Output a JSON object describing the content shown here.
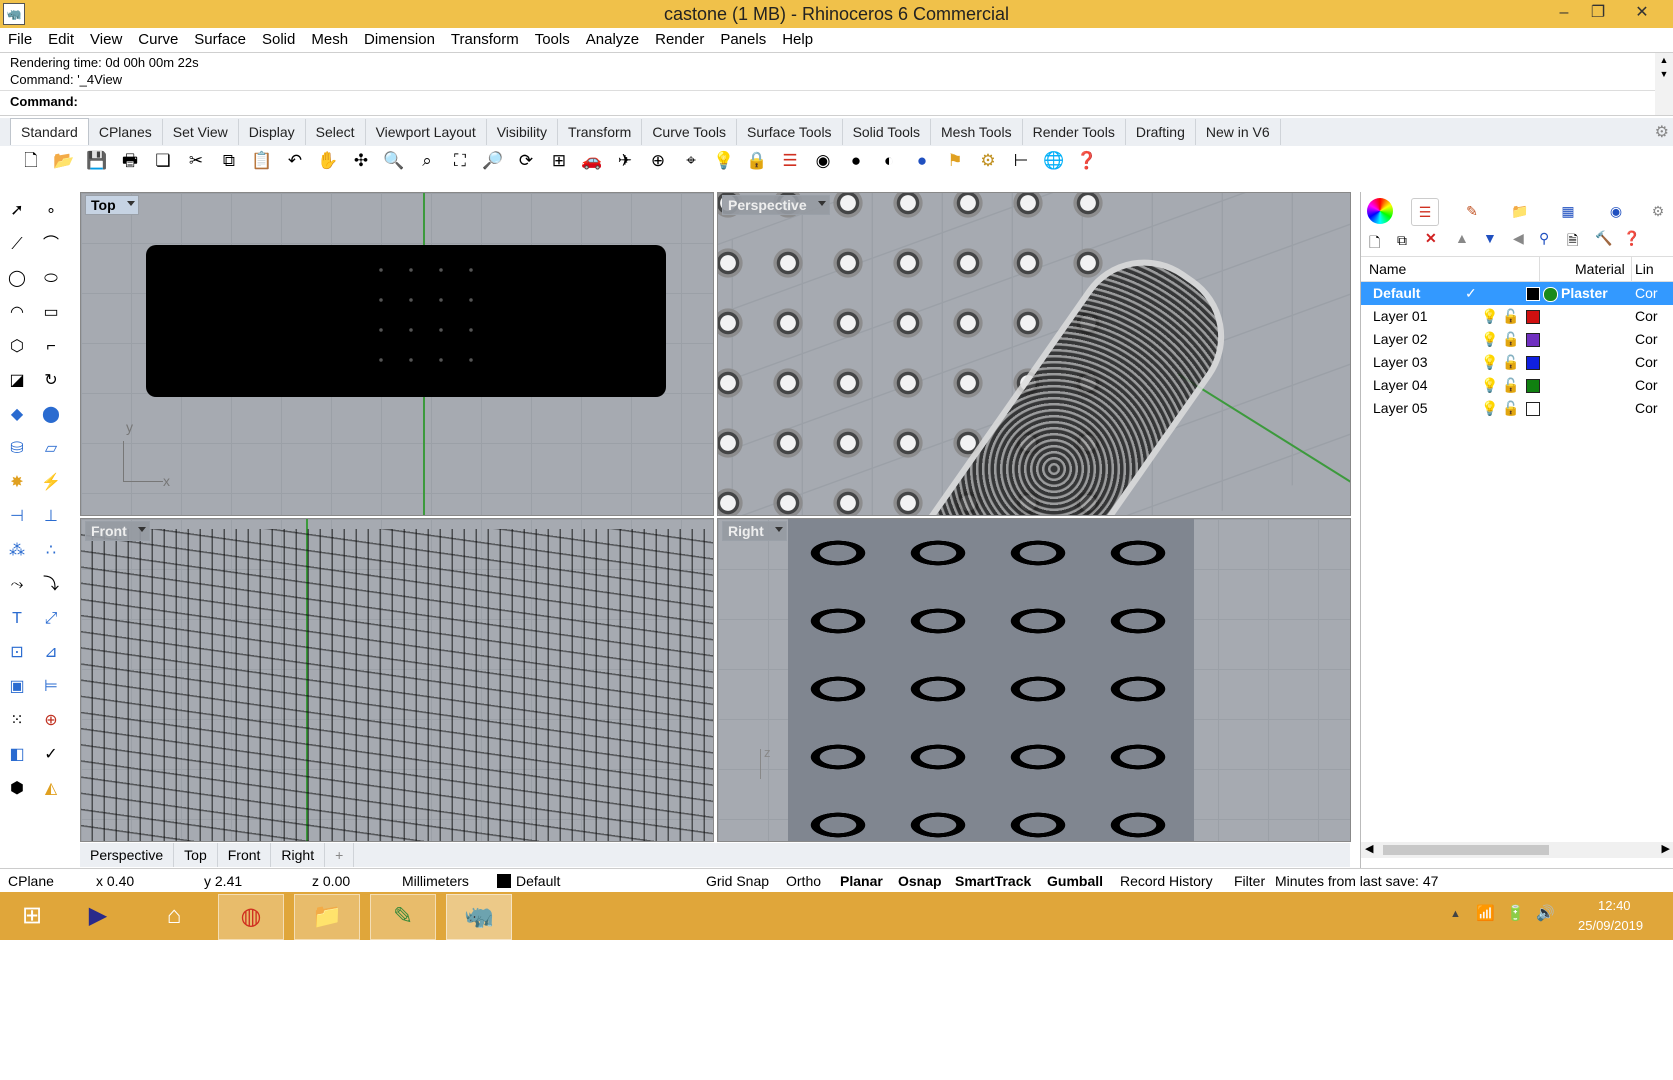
{
  "window": {
    "title": "castone (1 MB) - Rhinoceros 6 Commercial",
    "app_icon": "rhino-icon",
    "minimize": "–",
    "restore": "❐",
    "close": "✕"
  },
  "menu": [
    "File",
    "Edit",
    "View",
    "Curve",
    "Surface",
    "Solid",
    "Mesh",
    "Dimension",
    "Transform",
    "Tools",
    "Analyze",
    "Render",
    "Panels",
    "Help"
  ],
  "command": {
    "history_1": "Rendering time: 0d 00h 00m 22s",
    "history_2": "Command: '_4View",
    "prompt_label": "Command:",
    "prompt_value": ""
  },
  "tabs": [
    "Standard",
    "CPlanes",
    "Set View",
    "Display",
    "Select",
    "Viewport Layout",
    "Visibility",
    "Transform",
    "Curve Tools",
    "Surface Tools",
    "Solid Tools",
    "Mesh Tools",
    "Render Tools",
    "Drafting",
    "New in V6"
  ],
  "active_tab": "Standard",
  "toolbar_icons": [
    "new-file-icon",
    "open-folder-icon",
    "save-icon",
    "print-icon",
    "import-icon",
    "cut-icon",
    "copy-icon",
    "paste-icon",
    "undo-icon",
    "pan-hand-icon",
    "rotate-view-icon",
    "zoom-icon",
    "zoom-window-icon",
    "zoom-extents-icon",
    "zoom-selected-icon",
    "rotate-icon",
    "four-view-icon",
    "car-render-icon",
    "ghost-icon",
    "cplane-icon",
    "snap-icon",
    "light-icon",
    "lock-icon",
    "layers-icon",
    "color-wheel-icon",
    "shade-icon",
    "render-sphere-icon",
    "blue-sphere-icon",
    "filter-icon",
    "gear-icon",
    "dimension-icon",
    "globe-icon",
    "help-icon"
  ],
  "viewports": {
    "top": {
      "label": "Top",
      "axis_x": "x",
      "axis_y": "y"
    },
    "perspective": {
      "label": "Perspective"
    },
    "front": {
      "label": "Front"
    },
    "right": {
      "label": "Right",
      "axis_z": "z"
    }
  },
  "layers_panel": {
    "columns": {
      "name": "Name",
      "material": "Material",
      "linetype": "Lin"
    },
    "rows": [
      {
        "name": "Default",
        "current": "✓",
        "color": "#000000",
        "material": "Plaster",
        "linetype": "Cor",
        "selected": true
      },
      {
        "name": "Layer 01",
        "color": "#d01010",
        "linetype": "Cor"
      },
      {
        "name": "Layer 02",
        "color": "#7030c0",
        "linetype": "Cor"
      },
      {
        "name": "Layer 03",
        "color": "#1020e0",
        "linetype": "Cor"
      },
      {
        "name": "Layer 04",
        "color": "#108010",
        "linetype": "Cor"
      },
      {
        "name": "Layer 05",
        "color": "#ffffff",
        "linetype": "Cor"
      }
    ]
  },
  "viewport_tabs": [
    "Perspective",
    "Top",
    "Front",
    "Right"
  ],
  "viewport_tab_add": "+",
  "status": {
    "cplane": "CPlane",
    "x": "x 0.40",
    "y": "y 2.41",
    "z": "z 0.00",
    "units": "Millimeters",
    "layer": "Default",
    "grid_snap": "Grid Snap",
    "ortho": "Ortho",
    "planar": "Planar",
    "osnap": "Osnap",
    "smarttrack": "SmartTrack",
    "gumball": "Gumball",
    "record_history": "Record History",
    "filter": "Filter",
    "save_info": "Minutes from last save: 47"
  },
  "taskbar": {
    "time": "12:40",
    "date": "25/09/2019"
  },
  "colors": {
    "title": "#f0c14a",
    "taskbar": "#e0a63a",
    "viewport_bg": "#a6aab1",
    "selection": "#3399ff"
  }
}
